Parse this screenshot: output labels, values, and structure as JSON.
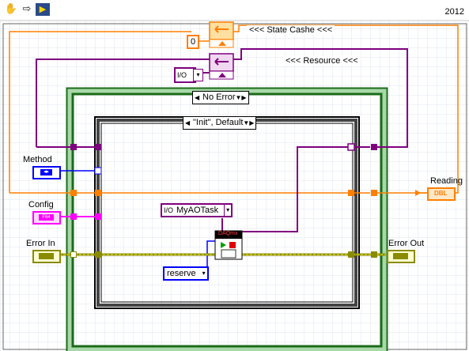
{
  "window": {
    "version_label": "2012",
    "toolbar": {
      "grab_icon": "hand-icon",
      "run_icon": "arrow-right-icon",
      "app_icon": "vi-icon"
    }
  },
  "annotations": {
    "state_cache": "<<< State Cashe <<<",
    "resource": "<<< Resource <<<"
  },
  "constants": {
    "state_initial": "0",
    "io_resource_glyph": "I/O",
    "ao_task_name": "MyAOTask",
    "task_action": "reserve"
  },
  "structures": {
    "outer_case_selector": "No Error",
    "inner_case_selector": "\"Init\", Default"
  },
  "terminals": {
    "method_label": "Method",
    "config_label": "Config",
    "error_in_label": "Error In",
    "error_out_label": "Error Out",
    "reading_label": "Reading",
    "reading_type": "DBL",
    "config_type": "F64",
    "method_type": "enum"
  },
  "nodes": {
    "daqmx_label": "DAQmx",
    "daqmx_icon": "daqmx-control-task-icon"
  },
  "colors": {
    "error_wire": "#c8c800",
    "numeric_orange": "#ff7f00",
    "refnum_purple": "#7f007f",
    "enum_blue": "#0000ff",
    "cluster_pink": "#ff00ff",
    "while_loop_green": "#1b6b1b",
    "loop_fill": "#a8d8a8",
    "grid": "#dfe6ee"
  }
}
